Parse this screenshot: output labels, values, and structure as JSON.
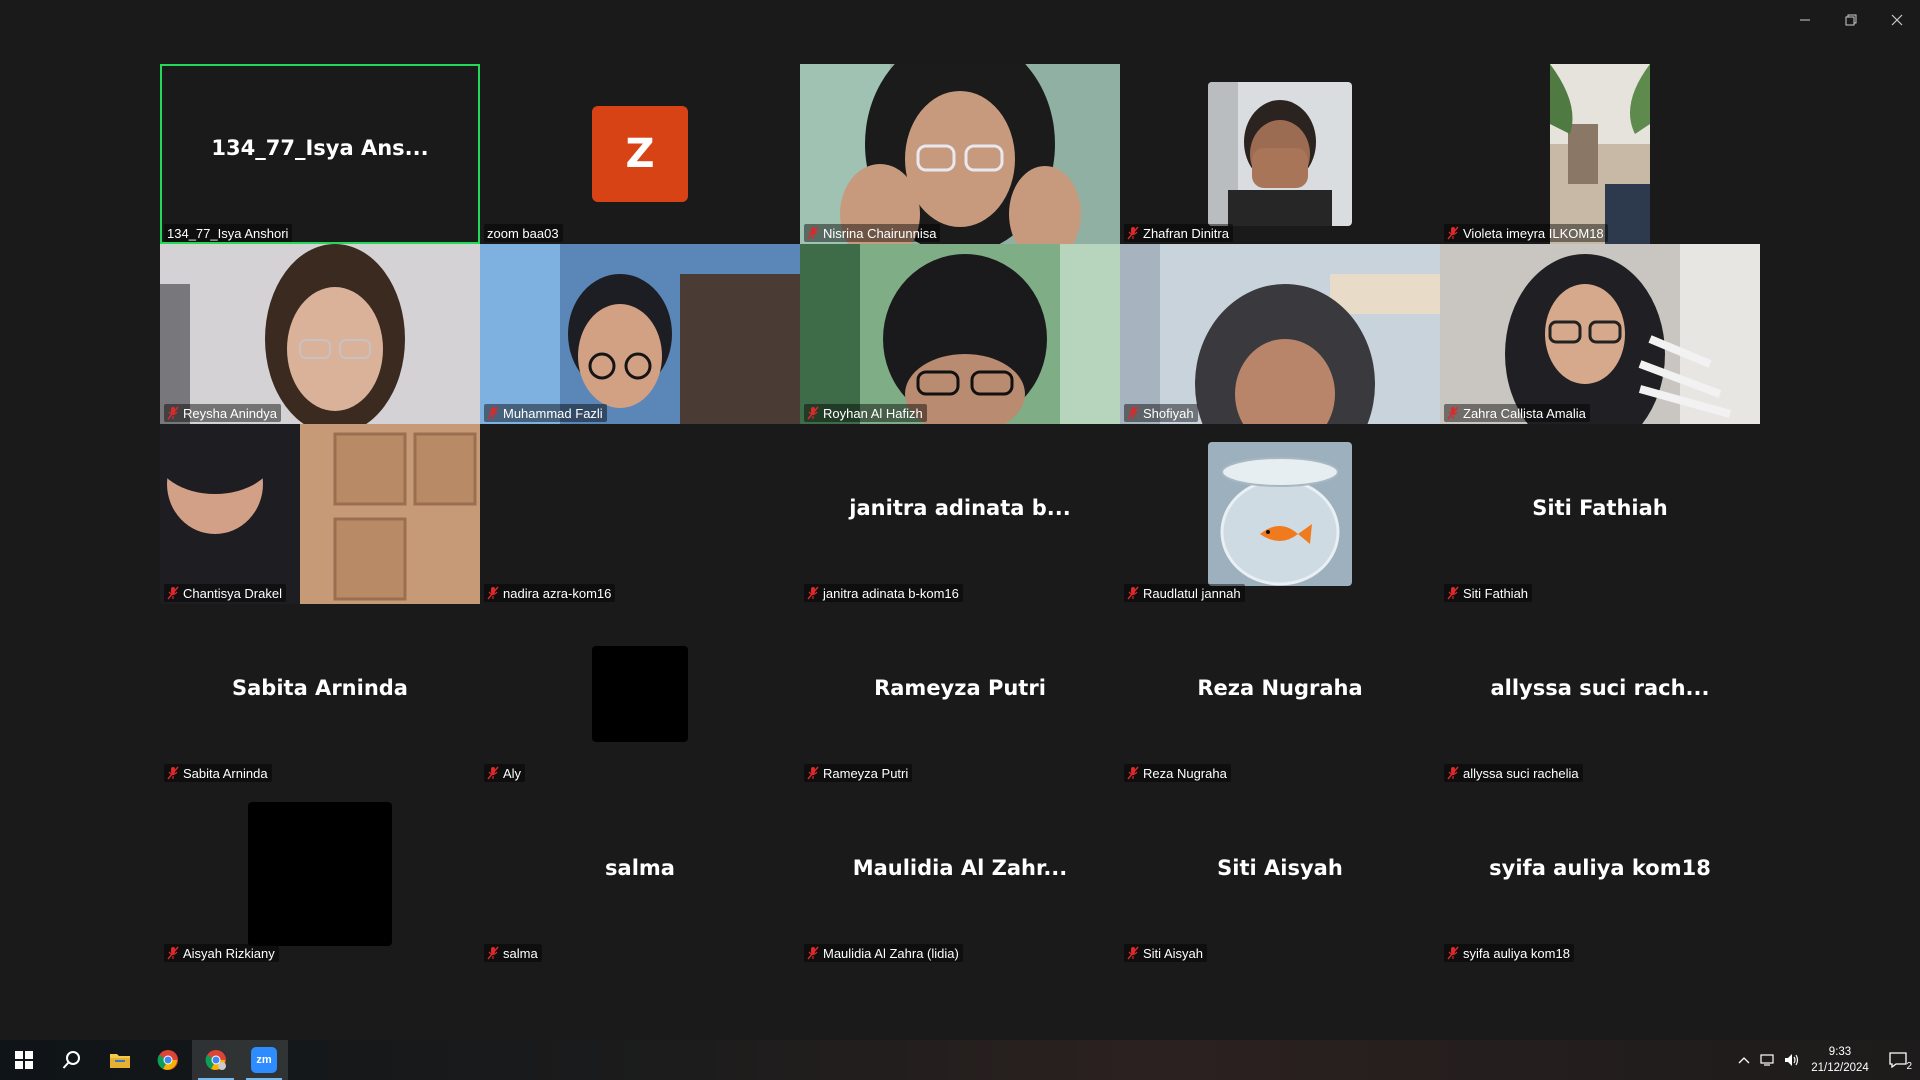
{
  "window": {
    "minimize_icon": "minimize-icon",
    "restore_icon": "restore-icon",
    "close_icon": "close-icon"
  },
  "colors": {
    "active_speaker_border": "#23d959",
    "avatar_z_bg": "#d84315",
    "muted_mic": "#e02828"
  },
  "participants": [
    {
      "label": "134_77_Isya Anshori",
      "display": "134_77_Isya Ans...",
      "kind": "name",
      "muted": false,
      "active": true
    },
    {
      "label": "zoom baa03",
      "display": "Z",
      "kind": "avatar",
      "muted": false
    },
    {
      "label": "Nisrina Chairunnisa",
      "kind": "video",
      "muted": true
    },
    {
      "label": "Zhafran Dinitra",
      "kind": "photo",
      "muted": true
    },
    {
      "label": "Violeta imeyra ILKOM18",
      "kind": "photo",
      "muted": true
    },
    {
      "label": "Reysha Anindya",
      "kind": "video",
      "muted": true
    },
    {
      "label": "Muhammad Fazli",
      "kind": "video",
      "muted": true
    },
    {
      "label": "Royhan Al Hafizh",
      "kind": "video",
      "muted": true
    },
    {
      "label": "Shofiyah",
      "kind": "video",
      "muted": true
    },
    {
      "label": "Zahra Callista Amalia",
      "kind": "video",
      "muted": true
    },
    {
      "label": "Chantisya Drakel",
      "kind": "video",
      "muted": true
    },
    {
      "label": "nadira azra-kom16",
      "kind": "empty",
      "muted": true
    },
    {
      "label": "janitra adinata b-kom16",
      "display": "janitra adinata b...",
      "kind": "name",
      "muted": true
    },
    {
      "label": "Raudlatul jannah",
      "kind": "photo",
      "muted": true
    },
    {
      "label": "Siti Fathiah",
      "display": "Siti Fathiah",
      "kind": "name",
      "muted": true
    },
    {
      "label": "Sabita Arninda",
      "display": "Sabita Arninda",
      "kind": "name",
      "muted": true
    },
    {
      "label": "Aly",
      "kind": "black-small",
      "muted": true
    },
    {
      "label": "Rameyza Putri",
      "display": "Rameyza Putri",
      "kind": "name",
      "muted": true
    },
    {
      "label": "Reza Nugraha",
      "display": "Reza Nugraha",
      "kind": "name",
      "muted": true
    },
    {
      "label": "allyssa suci rachelia",
      "display": "allyssa suci rach...",
      "kind": "name",
      "muted": true
    },
    {
      "label": "Aisyah Rizkiany",
      "kind": "black",
      "muted": true
    },
    {
      "label": "salma",
      "display": "salma",
      "kind": "name",
      "muted": true
    },
    {
      "label": "Maulidia Al Zahra (lidia)",
      "display": "Maulidia Al Zahr...",
      "kind": "name",
      "muted": true
    },
    {
      "label": "Siti Aisyah",
      "display": "Siti Aisyah",
      "kind": "name",
      "muted": true
    },
    {
      "label": "syifa auliya kom18",
      "display": "syifa auliya kom18",
      "kind": "name",
      "muted": true
    }
  ],
  "taskbar": {
    "apps": [
      "windows-start-icon",
      "search-icon",
      "file-explorer-icon",
      "chrome-icon",
      "chrome-profile-icon",
      "zoom-icon"
    ],
    "zoom_label": "zm",
    "time": "9:33",
    "date": "21/12/2024",
    "notification_count": "2"
  }
}
